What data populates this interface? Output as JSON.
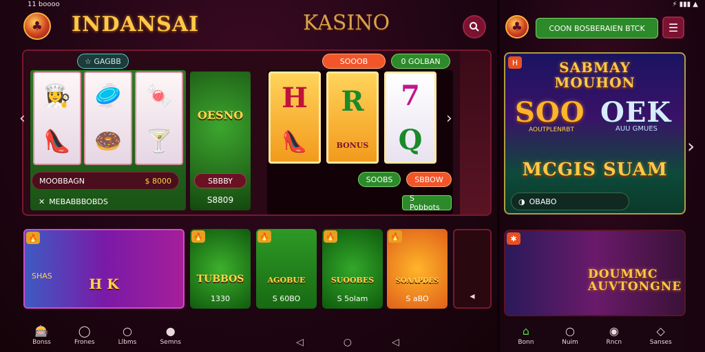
{
  "status": {
    "left_time": "11 boooo",
    "right_icons": "⚡ ▮▮▮ ▲"
  },
  "header": {
    "logo_icon": "chip-logo-icon",
    "brand": "INDANSAI",
    "center_title": "KASINO"
  },
  "right_header": {
    "cta": "COON BOSBERAIEN BTCK"
  },
  "featured": {
    "top_pill": "☆ GAGBB",
    "tag1": "SOOOB",
    "tag2": "0 GOLBAN",
    "center_game": "OESNO",
    "bar1_label": "MOOBBAGN",
    "bar1_value": "$ 8000",
    "bar2_label": "MEBABBBOBDS",
    "center_pill": "SBBBY",
    "center_value": "S8809",
    "spin_label": "SOOBS",
    "spin_btn": "SBBOW",
    "paytable": "S Pobbots",
    "slot_symbols": [
      "H",
      "R",
      "7"
    ],
    "slot_symbols_bottom": [
      "👠",
      "BONUS",
      "Q"
    ],
    "reel_top": [
      "👩‍🍳",
      "🥏",
      "🍬"
    ],
    "reel_bottom": [
      "👠",
      "🍩",
      "🍸"
    ]
  },
  "promo": {
    "title_line1": "SABMAY",
    "title_line2": "MOUHON",
    "big1": "SOO",
    "big2": "OEK",
    "sub": "AOUTPLENRBT",
    "sub2": "AUU GMUES",
    "cta": "MCGIS SUAM",
    "footer": "OBABO"
  },
  "thumbs": [
    {
      "title": "SHAS",
      "footer": ""
    },
    {
      "title": "H  K",
      "footer": ""
    },
    {
      "title": "TUBBOS",
      "footer": "1330"
    },
    {
      "title": "AGOBUE",
      "footer": "S 60BO"
    },
    {
      "title": "SUOOBES",
      "footer": "S 5olam"
    },
    {
      "title": "SOAAPDES",
      "footer": "S aBO"
    }
  ],
  "promo2": {
    "title": "DOUMMC AUVTONGNE"
  },
  "nav_left": [
    {
      "label": "Bonss",
      "icon": "home-icon"
    },
    {
      "label": "Frones",
      "icon": "flame-icon"
    },
    {
      "label": "Llbms",
      "icon": "search-icon"
    },
    {
      "label": "Semns",
      "icon": "profile-icon"
    }
  ],
  "nav_right": [
    {
      "label": "Bonn",
      "icon": "home-icon"
    },
    {
      "label": "Nuim",
      "icon": "search-icon"
    },
    {
      "label": "Rncn",
      "icon": "profile-icon"
    },
    {
      "label": "Sanses",
      "icon": "gem-icon"
    }
  ],
  "colors": {
    "accent": "#ffc947",
    "panel_border": "#7a1830",
    "green": "#2d7a24",
    "orange": "#f2552a"
  }
}
